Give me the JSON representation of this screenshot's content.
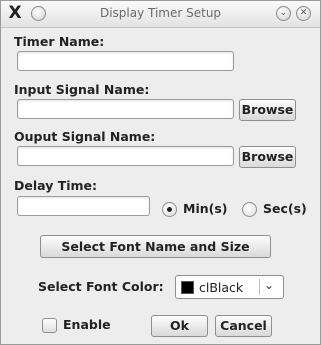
{
  "window": {
    "title": "Display Timer Setup",
    "app_icon": "X",
    "icons": {
      "app": "x-logo-icon",
      "menu": "window-menu-icon",
      "minimize": "chevron-down-icon",
      "close": "close-icon"
    }
  },
  "form": {
    "timer_name": {
      "label": "Timer Name:",
      "value": ""
    },
    "input_signal": {
      "label": "Input Signal Name:",
      "value": "",
      "browse_label": "Browse"
    },
    "output_signal": {
      "label": "Ouput Signal Name:",
      "value": "",
      "browse_label": "Browse"
    },
    "delay_time": {
      "label": "Delay Time:",
      "value": "",
      "unit_options": [
        {
          "label": "Min(s)",
          "selected": true
        },
        {
          "label": "Sec(s)",
          "selected": false
        }
      ]
    },
    "font_button_label": "Select Font Name and Size",
    "font_color": {
      "label": "Select Font Color:",
      "selected": "clBlack",
      "swatch_color": "#000000"
    },
    "enable": {
      "label": "Enable",
      "checked": false
    },
    "ok_label": "Ok",
    "cancel_label": "Cancel"
  }
}
